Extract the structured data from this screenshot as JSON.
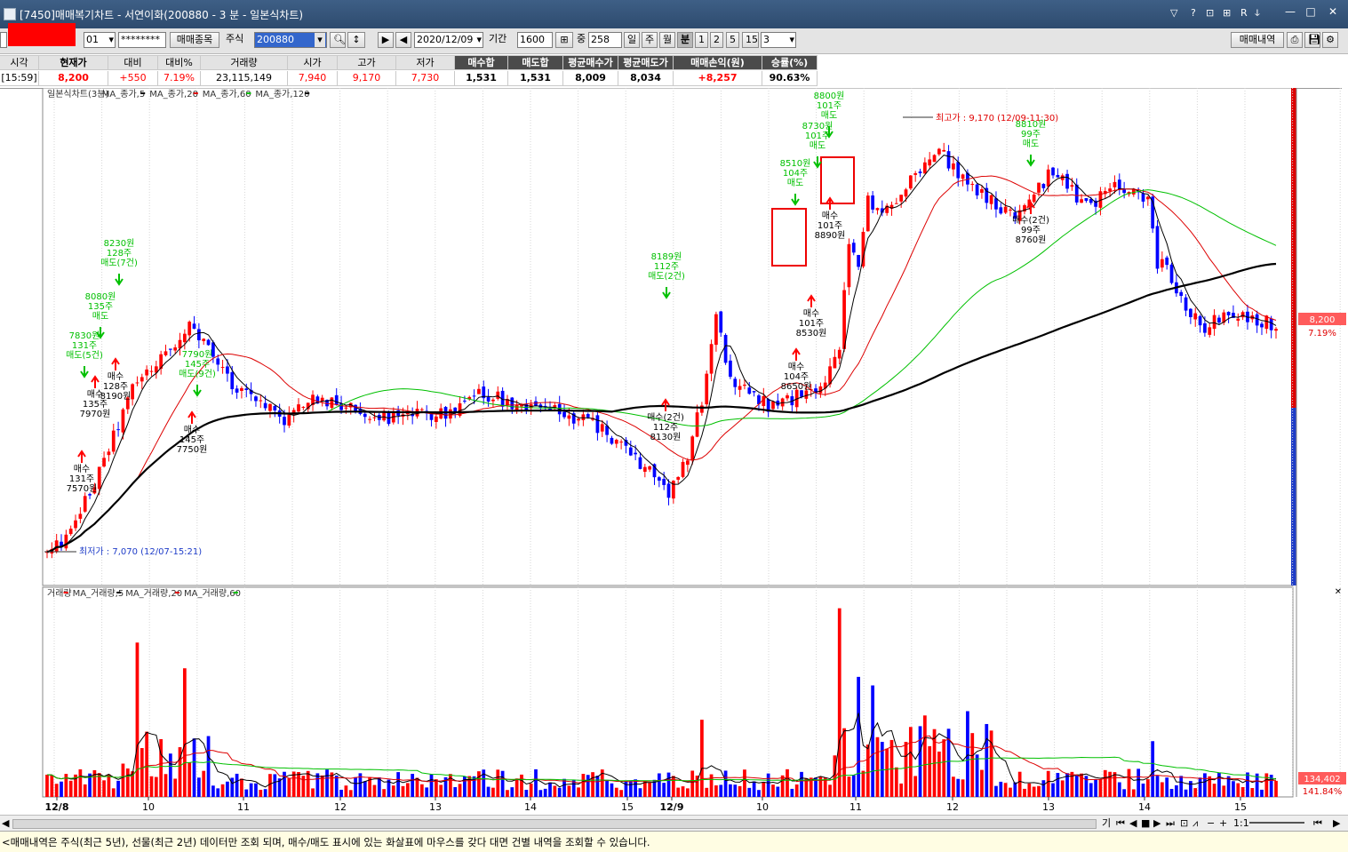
{
  "window": {
    "title": "[7450]매매복기차트 - 서연이화(200880 - 3 분 - 일본식차트)",
    "controls": [
      "▽",
      "?",
      "⊡",
      "⊞",
      "R",
      "ↆ"
    ],
    "min": "—",
    "max": "□",
    "close": "✕"
  },
  "toolbar": {
    "account_suffix": "01",
    "password": "********",
    "btn_trade_items": "매매종목",
    "label_stock": "주식",
    "stock_code": "200880",
    "date": "2020/12/09",
    "label_period": "기간",
    "period_value": "1600",
    "label_mid": "중",
    "count_value": "258",
    "periods": [
      "일",
      "주",
      "월",
      "분",
      "1",
      "2",
      "5",
      "15"
    ],
    "active_period": "분",
    "minute_value": "3",
    "btn_trade_history": "매매내역"
  },
  "info_header": {
    "headers": [
      "시각",
      "현재가",
      "대비",
      "대비%",
      "거래량",
      "시가",
      "고가",
      "저가",
      "매수합",
      "매도합",
      "평균매수가",
      "평균매도가",
      "매매손익(원)",
      "승률(%)"
    ],
    "values": [
      "[15:59]",
      "8,200",
      "+550",
      "7.19%",
      "23,115,149",
      "7,940",
      "9,170",
      "7,730",
      "1,531",
      "1,531",
      "8,009",
      "8,034",
      "+8,257",
      "90.63%"
    ]
  },
  "chart_data": {
    "type": "candlestick",
    "price_legend": [
      "일본식차트(3분)",
      "MA_종가,5",
      "MA_종가,20",
      "MA_종가,60",
      "MA_종가,120"
    ],
    "volume_legend": [
      "거래량",
      "MA_거래량,5",
      "MA_거래량,20",
      "MA_거래량,60"
    ],
    "x_ticks": [
      "12/8",
      "10",
      "11",
      "12",
      "13",
      "14",
      "15",
      "12/9",
      "10",
      "11",
      "12",
      "13",
      "14",
      "15"
    ],
    "high_label": "최고가 : 9,170 (12/09-11:30)",
    "low_label": "최저가 : 7,070 (12/07-15:21)",
    "current_price": "8,200",
    "current_change": "7.19%",
    "current_volume": "134,402",
    "volume_change": "141.84%",
    "price_range": [
      7000,
      9300
    ],
    "sell_annotations": [
      [
        "7830원",
        "131주",
        "매도(5건)"
      ],
      [
        "8080원",
        "135주",
        "매도"
      ],
      [
        "8230원",
        "128주",
        "매도(7건)"
      ],
      [
        "7790원",
        "145주",
        "매도(9건)"
      ],
      [
        "8189원",
        "112주",
        "매도(2건)"
      ],
      [
        "8510원",
        "104주",
        "매도"
      ],
      [
        "8730원",
        "101주",
        "매도"
      ],
      [
        "8800원",
        "101주",
        "매도"
      ],
      [
        "8810원",
        "99주",
        "매도"
      ]
    ],
    "buy_annotations": [
      [
        "매수",
        "131주",
        "7570원"
      ],
      [
        "매수",
        "135주",
        "7970원"
      ],
      [
        "매수",
        "128주",
        "8190원"
      ],
      [
        "매수",
        "145주",
        "7750원"
      ],
      [
        "매수(2건)",
        "112주",
        "8130원"
      ],
      [
        "매수",
        "104주",
        "8650원"
      ],
      [
        "매수",
        "101주",
        "8530원"
      ],
      [
        "매수",
        "101주",
        "8890원"
      ],
      [
        "매수(2건)",
        "99주",
        "8760원"
      ]
    ]
  },
  "nav": {
    "buttons": [
      "기",
      "⏮",
      "◀",
      "■",
      "▶",
      "⏭",
      "⊡",
      "⩘",
      "−",
      "+",
      "1:1"
    ]
  },
  "status": {
    "message": "<매매내역은 주식(최근 5년), 선물(최근 2년) 데이터만 조회 되며, 매수/매도 표시에 있는 화살표에 마우스를 갖다 대면 건별 내역을 조회할 수 있습니다."
  },
  "colors": {
    "up": "#ff0000",
    "down": "#0000ff",
    "ma5": "#000000",
    "ma20": "#dd0000",
    "ma60": "#00c000",
    "ma120": "#000000",
    "sell_arrow": "#00c000",
    "buy_arrow": "#ff0000",
    "title_bar": "#2e4b6e"
  }
}
